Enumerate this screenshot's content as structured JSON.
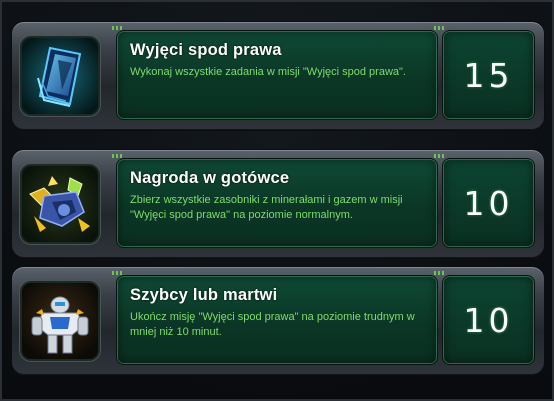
{
  "achievements": [
    {
      "title": "Wyjęci spod prawa",
      "description": "Wykonaj wszystkie zadania w misji \"Wyjęci spod prawa\".",
      "points": "15",
      "icon": "blue-card-icon"
    },
    {
      "title": "Nagroda w gotówce",
      "description": "Zbierz wszystkie zasobniki z minerałami i gazem w misji \"Wyjęci spod prawa\" na poziomie normalnym.",
      "points": "10",
      "icon": "reward-machine-icon"
    },
    {
      "title": "Szybcy lub martwi",
      "description": "Ukończ misję \"Wyjęci spod prawa\" na poziomie trudnym w mniej niż 10 minut.",
      "points": "10",
      "icon": "space-marine-icon"
    }
  ],
  "colors": {
    "panel_green": "#0f4a35",
    "description_text": "#7fdc6a",
    "title_text": "#ffffff"
  }
}
